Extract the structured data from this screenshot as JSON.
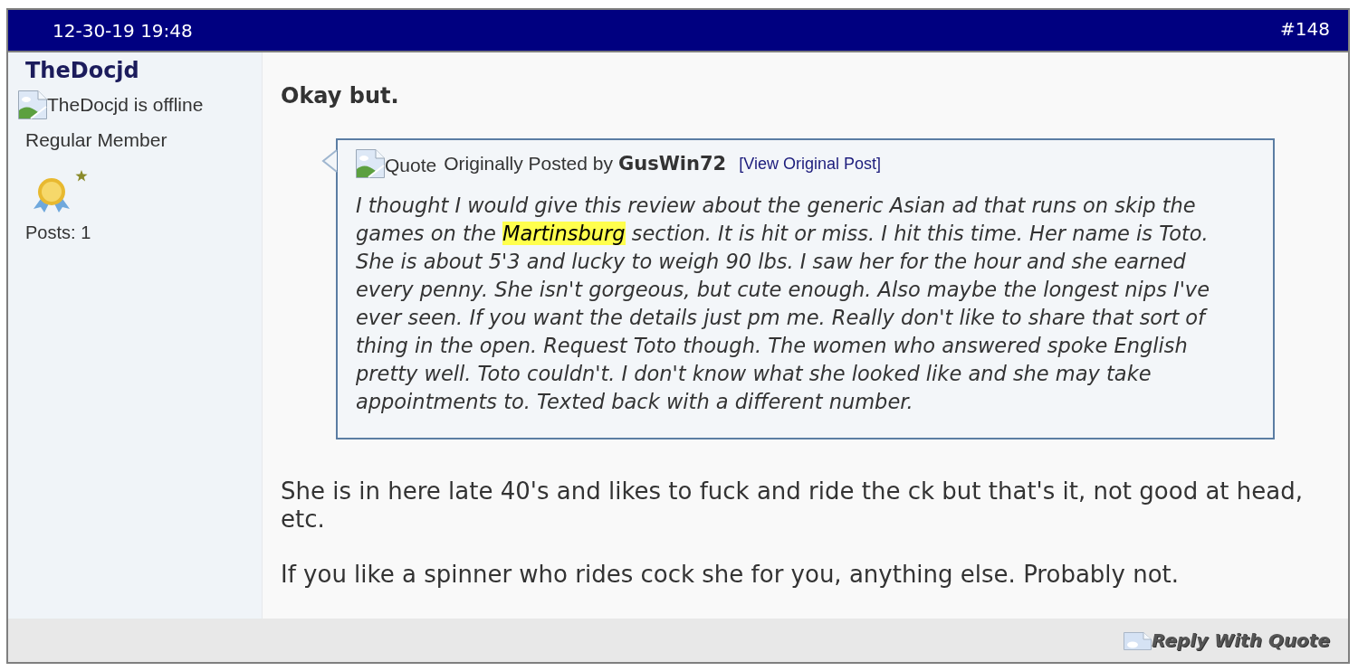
{
  "post": {
    "date": "12-30-19 19:48",
    "number": "#148"
  },
  "author": {
    "username": "TheDocjd",
    "status_text": "TheDocjd is offline",
    "rank": "Regular Member",
    "posts": "Posts: 1"
  },
  "message": {
    "title": "Okay but.",
    "quote": {
      "icon_text": "Quote",
      "prefix": "Originally Posted by",
      "author": "GusWin72",
      "link": "[View Original Post]",
      "segments": [
        {
          "text": "I thought I would give this review about the generic Asian ad that runs on skip the games on the ",
          "highlighted": false
        },
        {
          "text": "Martinsburg",
          "highlighted": true
        },
        {
          "text": " section. It is hit or miss. I hit this time. Her name is Toto. She is about 5'3 and lucky to weigh 90 lbs. I saw her for the hour and she earned every penny. She isn't gorgeous, but cute enough. Also maybe the longest nips I've ever seen. If you want the details just pm me. Really don't like to share that sort of thing in the open. Request Toto though. The women who answered spoke English pretty well. Toto couldn't. I don't know what she looked like and she may take appointments to. Texted back with a different number.",
          "highlighted": false
        }
      ]
    },
    "paragraphs": [
      "She is in here late 40's and likes to fuck and ride the ck but that's it, not good at head, etc.",
      "If you like a spinner who rides cock she for you, anything else. Probably not."
    ]
  },
  "footer": {
    "buttons": [
      "Reply With Quote"
    ]
  }
}
